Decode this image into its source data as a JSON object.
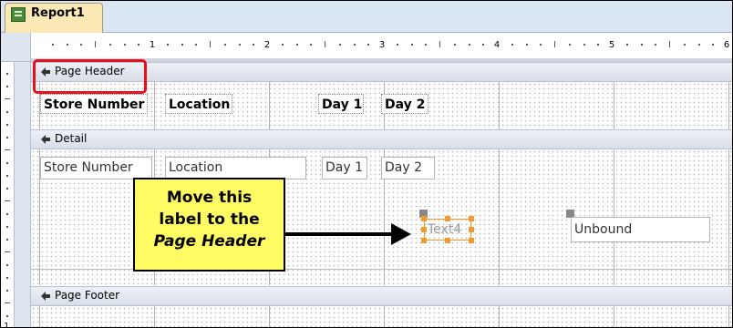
{
  "tab": {
    "title": "Report1"
  },
  "ruler": {
    "h_numbers": [
      "1",
      "2",
      "3",
      "4",
      "5",
      "6"
    ],
    "v_numbers": [
      "1"
    ]
  },
  "sections": {
    "page_header": "Page Header",
    "detail": "Detail",
    "page_footer": "Page Footer"
  },
  "page_header_labels": [
    "Store Number",
    "Location",
    "Day 1",
    "Day 2"
  ],
  "detail_fields": [
    "Store Number",
    "Location",
    "Day 1",
    "Day 2"
  ],
  "selected_label": "Text4",
  "unbound_field": "Unbound",
  "callout": {
    "line1": "Move this",
    "line2": "label to the",
    "line3": "Page Header"
  },
  "colors": {
    "highlight": "#e8101c",
    "callout_bg": "#fffd63",
    "selection": "#f29a32",
    "tab_bg": "#fbe9b5"
  },
  "icons": [
    "report-icon",
    "section-collapse-icon",
    "arrow-right-icon"
  ]
}
